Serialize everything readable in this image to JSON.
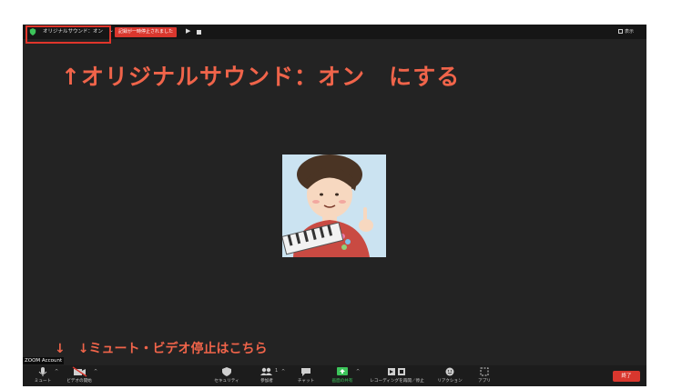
{
  "topbar": {
    "sound_label": "オリジナルサウンド：オン",
    "recording_badge": "記録が一時停止されました",
    "view_label": "表示"
  },
  "annotations": {
    "top": "↑オリジナルサウンド：オン　にする",
    "bottom": "↓　↓ミュート・ビデオ停止はこちら"
  },
  "zoom_account": "ZOOM Account",
  "toolbar": {
    "mute": "ミュート",
    "video": "ビデオの開始",
    "security": "セキュリティ",
    "participants": "参加者",
    "participants_count": "1",
    "chat": "チャット",
    "share": "画面の共有",
    "recording": "レコーディングを再開／停止",
    "reactions": "リアクション",
    "apps": "アプリ",
    "end": "終了"
  },
  "colors": {
    "accent_red": "#d9372e",
    "annotation_orange": "#f0644a",
    "share_green": "#3cc45a",
    "window_bg": "#232323"
  }
}
